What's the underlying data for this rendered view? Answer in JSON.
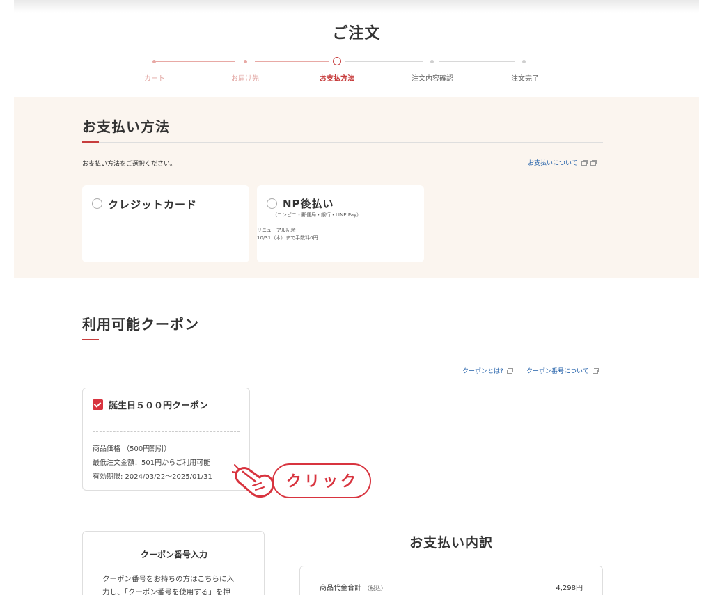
{
  "page": {
    "title": "ご注文"
  },
  "steps": [
    {
      "label": "カート",
      "state": "done"
    },
    {
      "label": "お届け先",
      "state": "done"
    },
    {
      "label": "お支払方法",
      "state": "current"
    },
    {
      "label": "注文内容確認",
      "state": "todo"
    },
    {
      "label": "注文完了",
      "state": "todo"
    }
  ],
  "payment": {
    "title": "お支払い方法",
    "instruction": "お支払い方法をご選択ください。",
    "about_link": "お支払いについて",
    "options": [
      {
        "label": "クレジットカード",
        "selected": false
      },
      {
        "label": "NP後払い",
        "subtitle": "（コンビニ・郵便局・銀行・LINE Pay）",
        "note_line1": "リニューアル記念！",
        "note_line2": "10/31（木）まで手数料0円",
        "selected": false
      }
    ]
  },
  "coupons": {
    "title": "利用可能クーポン",
    "link_what": "クーポンとは?",
    "link_code": "クーポン番号について",
    "items": [
      {
        "name": "誕生日５００円クーポン",
        "checked": true,
        "line1": "商品価格 （500円割引）",
        "line2": "最低注文金額：501円からご利用可能",
        "line3": "有効期限: 2024/03/22〜2025/01/31"
      }
    ]
  },
  "callout": {
    "text": "クリック"
  },
  "coupon_code": {
    "title": "クーポン番号入力",
    "description_line1": "クーポン番号をお持ちの方はこちらに入",
    "description_line2": "力し、「クーポン番号を使用する」を押"
  },
  "breakdown": {
    "title": "お支払い内訳",
    "rows": [
      {
        "label": "商品代金合計",
        "tax_note": "（税込）",
        "value": "4,298円"
      }
    ]
  },
  "colors": {
    "accent": "#c73d3d",
    "band": "#fbf5ef",
    "link": "#1f5ea8",
    "step_done": "#e8a9a5",
    "step_todo": "#d0d0d0"
  }
}
